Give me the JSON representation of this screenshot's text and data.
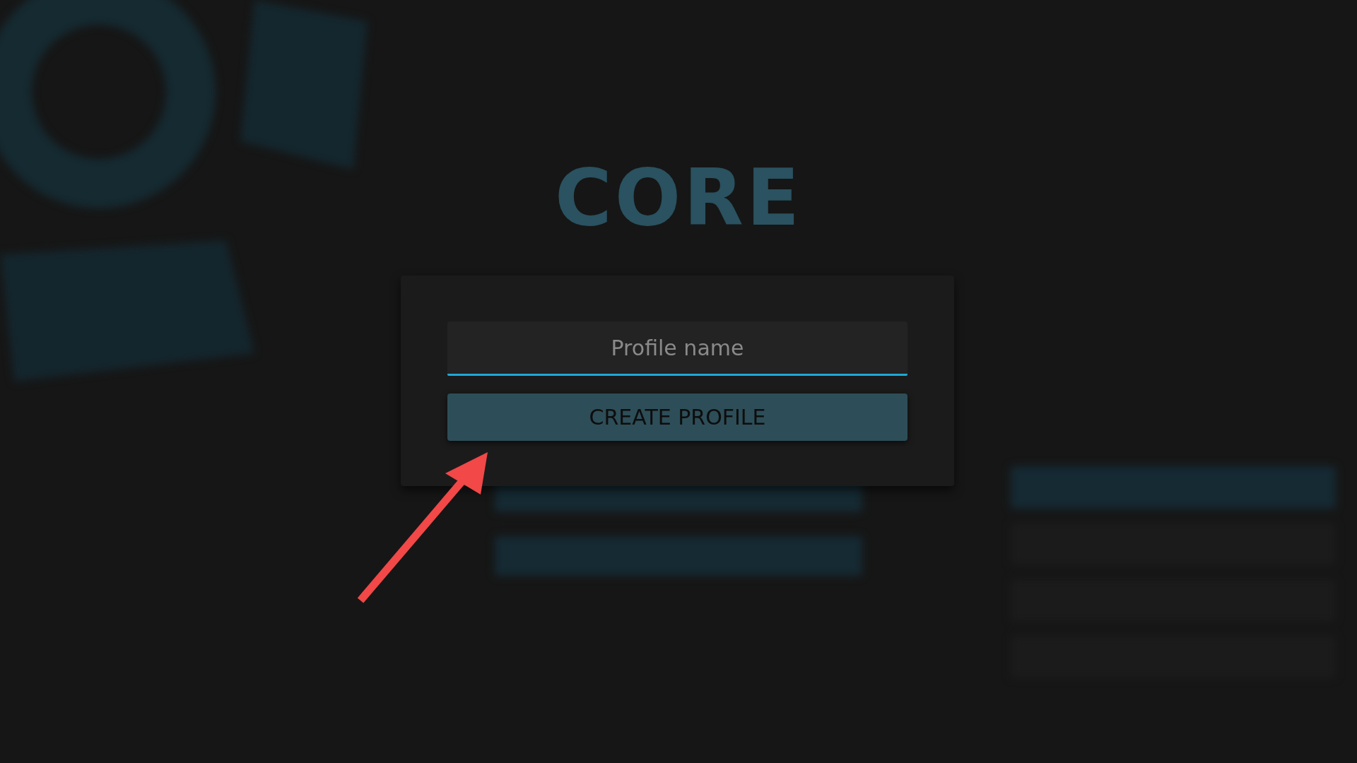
{
  "background": {
    "title": "CORE"
  },
  "dialog": {
    "field": {
      "placeholder": "Profile name",
      "focused": true
    },
    "button": {
      "label": "CREATE PROFILE"
    }
  }
}
